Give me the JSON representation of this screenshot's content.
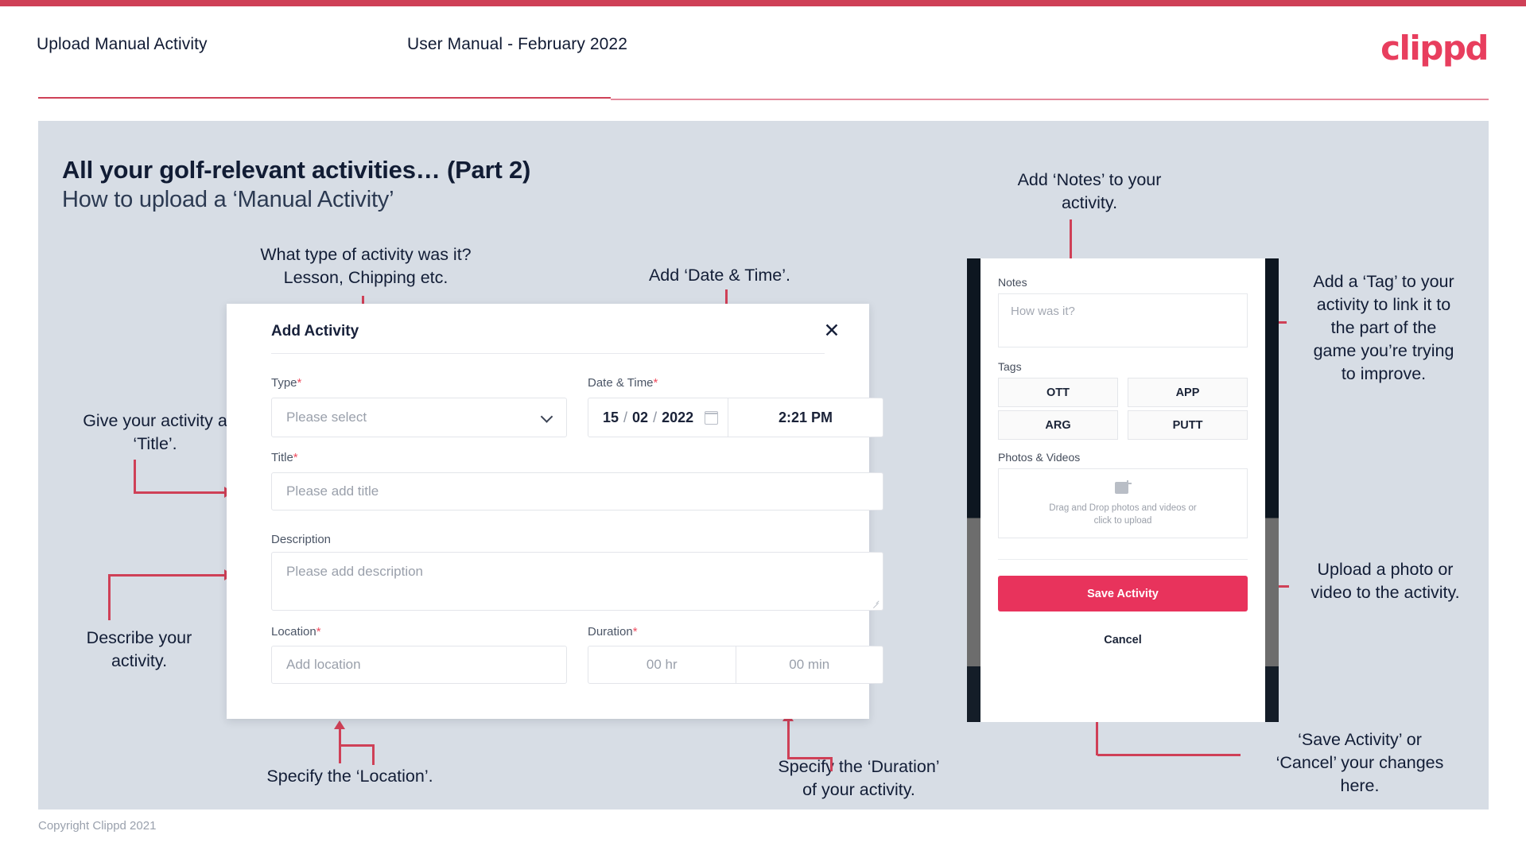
{
  "header": {
    "title": "Upload Manual Activity",
    "subtitle": "User Manual - February 2022",
    "logo": "clippd"
  },
  "slide": {
    "title": "All your golf-relevant activities… (Part 2)",
    "subtitle": "How to upload a ‘Manual Activity’"
  },
  "annotations": {
    "type": "What type of activity was it?\nLesson, Chipping etc.",
    "datetime": "Add ‘Date & Time’.",
    "title": "Give your activity a\n‘Title’.",
    "description": "Describe your\nactivity.",
    "location": "Specify the ‘Location’.",
    "duration": "Specify the ‘Duration’\nof your activity.",
    "notes": "Add ‘Notes’ to your\nactivity.",
    "tags": "Add a ‘Tag’ to your\nactivity to link it to\nthe part of the\ngame you’re trying\nto improve.",
    "upload": "Upload a photo or\nvideo to the activity.",
    "save": "‘Save Activity’ or\n‘Cancel’ your changes\nhere."
  },
  "dialog": {
    "title": "Add Activity",
    "close_icon": "close-icon",
    "fields": {
      "type": {
        "label": "Type",
        "required": "*",
        "placeholder": "Please select"
      },
      "datetime": {
        "label": "Date & Time",
        "required": "*",
        "day": "15",
        "month": "02",
        "year": "2022",
        "sep1": "/",
        "sep2": "/",
        "time": "2:21 PM"
      },
      "title": {
        "label": "Title",
        "required": "*",
        "placeholder": "Please add title"
      },
      "description": {
        "label": "Description",
        "required": "",
        "placeholder": "Please add description"
      },
      "location": {
        "label": "Location",
        "required": "*",
        "placeholder": "Add location"
      },
      "duration": {
        "label": "Duration",
        "required": "*",
        "hours": "00 hr",
        "minutes": "00 min"
      }
    }
  },
  "phone": {
    "notes": {
      "label": "Notes",
      "placeholder": "How was it?"
    },
    "tags": {
      "label": "Tags",
      "items": [
        "OTT",
        "APP",
        "ARG",
        "PUTT"
      ]
    },
    "media": {
      "label": "Photos & Videos",
      "drop_line1": "Drag and Drop photos and videos or",
      "drop_line2": "click to upload",
      "icon": "add-image-icon"
    },
    "save_label": "Save Activity",
    "cancel_label": "Cancel"
  },
  "footer": {
    "copyright": "Copyright Clippd 2021"
  },
  "colors": {
    "accent": "#cf4057",
    "brand": "#e83e5e",
    "save_button": "#e8335c",
    "slide_bg": "#d7dde5",
    "text_dark": "#121d36"
  }
}
